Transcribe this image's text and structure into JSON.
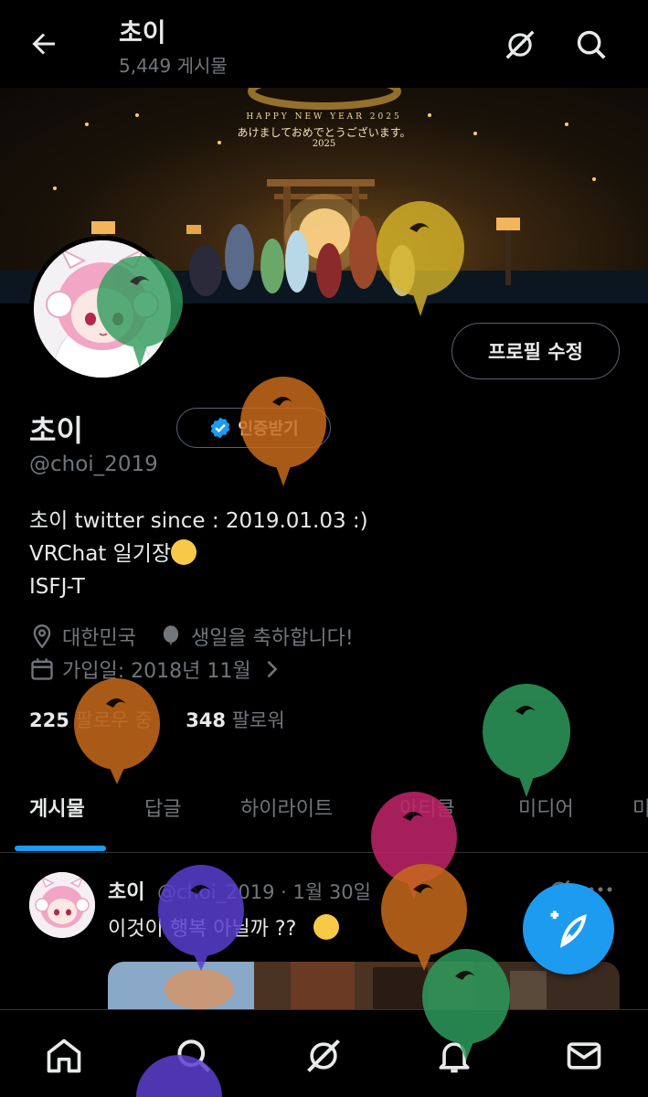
{
  "header": {
    "title": "초이",
    "post_count": "5,449 게시물"
  },
  "banner": {
    "line1": "HAPPY NEW YEAR 2025",
    "line2": "あけましておめでとうございます。",
    "line3": "2025"
  },
  "profile": {
    "edit_button": "프로필 수정",
    "name": "초이",
    "verify_button": "인증받기",
    "handle": "@choi_2019",
    "bio": [
      "초이 twitter since : 2019.01.03 :)",
      "VRChat 일기장",
      "ISFJ-T"
    ],
    "location": "대한민국",
    "birthday": "생일을 축하합니다!",
    "joined": "가입일: 2018년 11월",
    "following_count": "225",
    "following_label": "팔로우 중",
    "followers_count": "348",
    "followers_label": "팔로워"
  },
  "tabs": [
    "게시물",
    "답글",
    "하이라이트",
    "아티클",
    "미디어",
    "미"
  ],
  "post": {
    "author": "초이",
    "meta": "@choi_2019 · 1월 30일",
    "text": "이것이 행복 아닐까 ??"
  },
  "colors": {
    "accent": "#1d9bf0",
    "muted": "#71767b",
    "text": "#e7e9ea",
    "balloon_green": "#2e9b5b",
    "balloon_yellow": "#d8b62a",
    "balloon_orange": "#c86a1c",
    "balloon_magenta": "#c2256a",
    "balloon_purple": "#5a3fcf"
  },
  "icons": {
    "back": "arrow-left-icon",
    "grok": "grok-icon",
    "search": "search-icon",
    "location": "location-pin-icon",
    "birthday": "balloon-icon",
    "calendar": "calendar-icon",
    "compose": "compose-feather-icon",
    "nav": [
      "home-icon",
      "search-icon",
      "grok-icon",
      "bell-icon",
      "mail-icon"
    ]
  }
}
